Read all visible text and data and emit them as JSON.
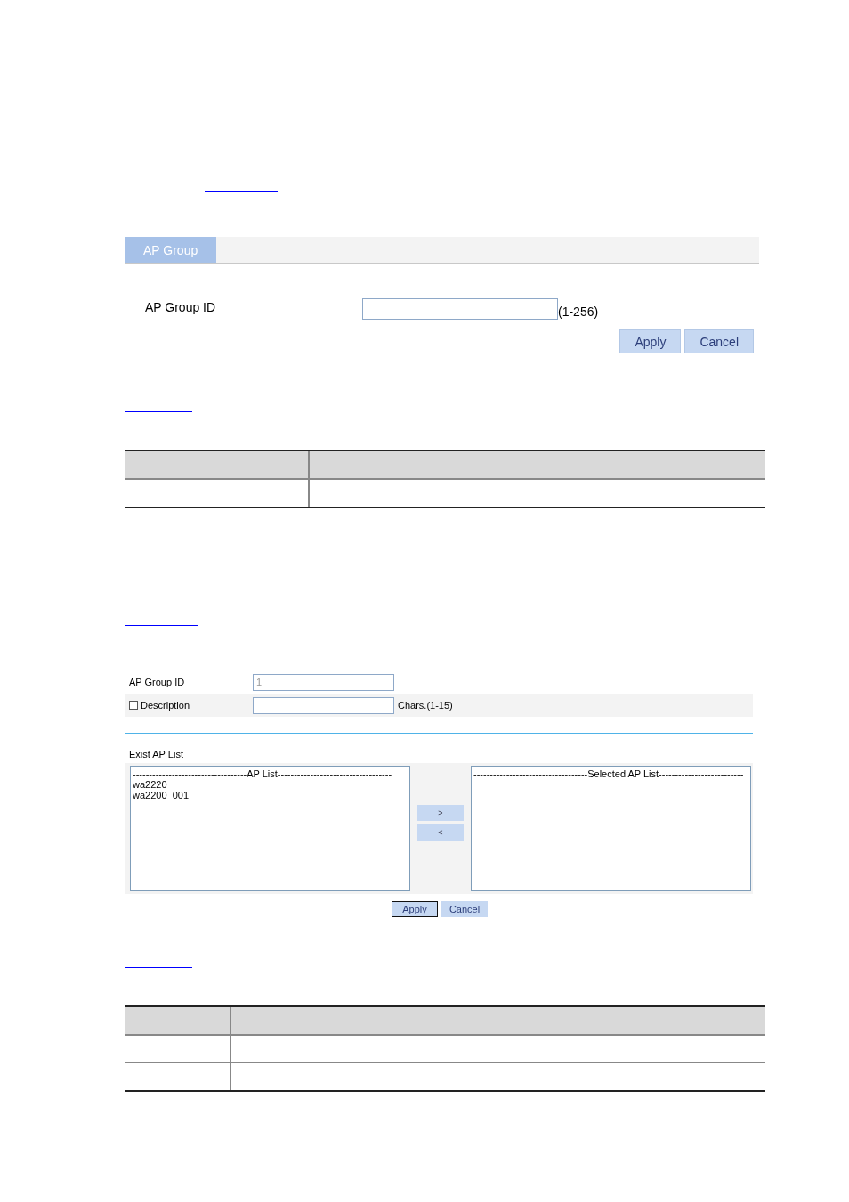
{
  "tab_panel": {
    "tabs": [
      {
        "label": "AP Group",
        "selected": true
      }
    ],
    "fields": [
      {
        "label": "AP Group ID",
        "hint": "(1-256)"
      }
    ],
    "buttons": [
      "Apply",
      "Cancel"
    ]
  },
  "group_form": {
    "fields": [
      {
        "kind": "text",
        "label": "AP Group ID",
        "value": "1",
        "disabled": true
      },
      {
        "kind": "checkbox",
        "label": "Description",
        "checked": false,
        "hint": "Chars.(1-15)"
      }
    ],
    "list_label": "Exist AP List",
    "available_list": {
      "header": "-----------------------------------AP List-----------------------------------",
      "items": [
        "wa2220",
        "wa2200_001"
      ]
    },
    "selected_list": {
      "header": "-----------------------------------Selected AP List--------------------------"
    },
    "move_buttons": [
      ">",
      "<"
    ],
    "buttons": [
      {
        "label": "Apply",
        "focused": true
      },
      {
        "label": "Cancel",
        "focused": false
      }
    ]
  }
}
